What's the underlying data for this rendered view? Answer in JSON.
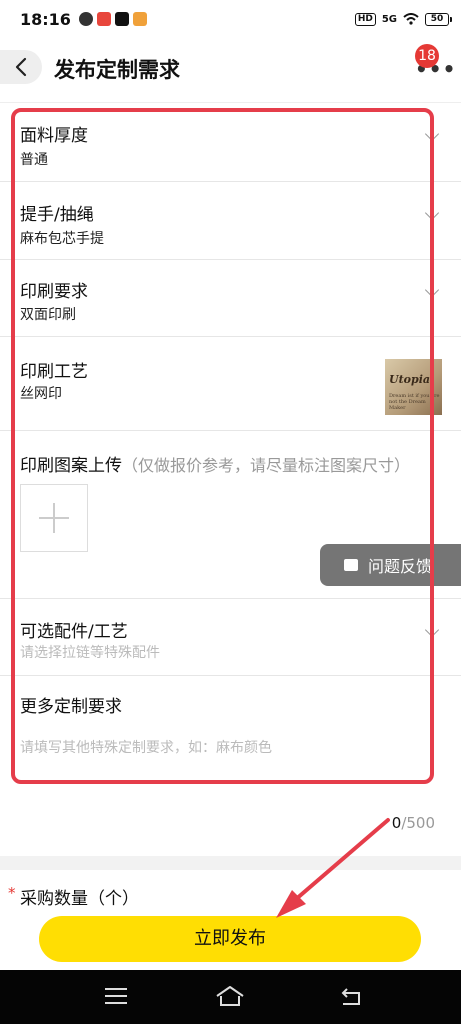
{
  "status_bar": {
    "time": "18:16",
    "hd": "HD",
    "signal": "5G",
    "battery": "50"
  },
  "header": {
    "title": "发布定制需求",
    "badge_count": "18",
    "more_icon": "more-dots-icon"
  },
  "form": {
    "fabric_thickness": {
      "label": "面料厚度",
      "value": "普通"
    },
    "handle_rope": {
      "label": "提手/抽绳",
      "value": "麻布包芯手提"
    },
    "print_requirement": {
      "label": "印刷要求",
      "value": "双面印刷"
    },
    "print_process": {
      "label": "印刷工艺",
      "value": "丝网印",
      "thumb_title": "Utopia",
      "thumb_sub": "Dream ist if you are not the Dream Maker"
    },
    "pattern_upload": {
      "label": "印刷图案上传",
      "hint": "（仅做报价参考，请尽量标注图案尺寸）"
    },
    "optional_parts": {
      "label": "可选配件/工艺",
      "placeholder": "请选择拉链等特殊配件"
    },
    "more_requirements": {
      "label": "更多定制要求",
      "placeholder": "请填写其他特殊定制要求，如：麻布颜色"
    },
    "char_count": "0",
    "char_max": "/500"
  },
  "feedback": {
    "label": "问题反馈"
  },
  "quantity": {
    "required_mark": "*",
    "label": "采购数量（个）"
  },
  "publish_button": {
    "label": "立即发布"
  },
  "colors": {
    "accent_yellow": "#ffde03",
    "annotation_red": "#e53d4a",
    "badge_red": "#e53935"
  }
}
